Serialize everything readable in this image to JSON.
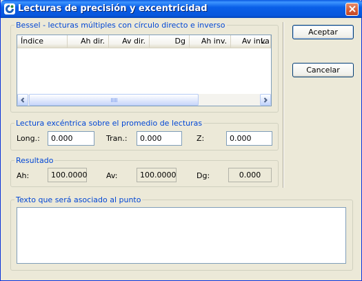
{
  "window": {
    "title": "Lecturas de precisión y excentricidad",
    "accent": "#0A5FE8",
    "group_title_color": "#0046D5"
  },
  "bessel": {
    "legend": "Bessel - lecturas múltiples con círculo directo e inverso",
    "columns": [
      "Índice",
      "Ah dir.",
      "Av dir.",
      "Dg",
      "Ah inv.",
      "Av inv.",
      "La"
    ],
    "rows": []
  },
  "eccentric": {
    "legend": "Lectura excéntrica sobre el promedio de lecturas",
    "long_label": "Long.:",
    "long_value": "0.000",
    "tran_label": "Tran.:",
    "tran_value": "0.000",
    "z_label": "Z:",
    "z_value": "0.000"
  },
  "result": {
    "legend": "Resultado",
    "ah_label": "Ah:",
    "ah_value": "100.0000",
    "av_label": "Av:",
    "av_value": "100.0000",
    "dg_label": "Dg:",
    "dg_value": "0.000"
  },
  "note": {
    "legend": "Texto que será asociado al punto",
    "value": ""
  },
  "buttons": {
    "accept": "Aceptar",
    "cancel": "Cancelar"
  },
  "icons": {
    "app": "app-logo-icon",
    "close": "close-x-icon",
    "scroll_left": "arrow-left-icon",
    "scroll_right": "arrow-right-icon",
    "grip": "scroll-grip-icon"
  }
}
